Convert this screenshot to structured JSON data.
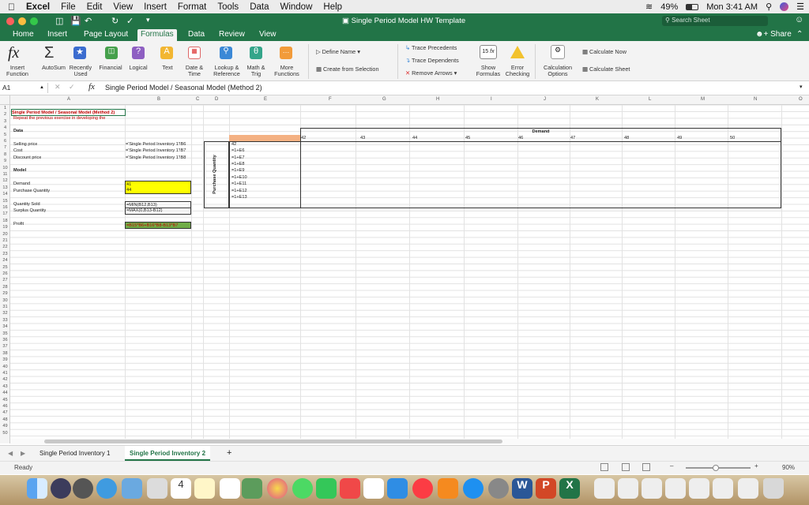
{
  "menubar": {
    "app": "Excel",
    "items": [
      "File",
      "Edit",
      "View",
      "Insert",
      "Format",
      "Tools",
      "Data",
      "Window",
      "Help"
    ],
    "battery": "49%",
    "clock": "Mon 3:41 AM"
  },
  "window": {
    "title": "Single Period Model HW Template",
    "search_placeholder": "Search Sheet"
  },
  "ribbon_tabs": [
    "Home",
    "Insert",
    "Page Layout",
    "Formulas",
    "Data",
    "Review",
    "View"
  ],
  "active_tab": "Formulas",
  "share_label": "Share",
  "ribbon": {
    "insert_function": "Insert\nFunction",
    "autosum": "AutoSum",
    "recently_used": "Recently\nUsed",
    "financial": "Financial",
    "logical": "Logical",
    "text": "Text",
    "date_time": "Date &\nTime",
    "lookup": "Lookup &\nReference",
    "math": "Math &\nTrig",
    "more": "More\nFunctions",
    "define_name": "Define Name",
    "create_from_selection": "Create from Selection",
    "trace_precedents": "Trace Precedents",
    "trace_dependents": "Trace Dependents",
    "remove_arrows": "Remove Arrows",
    "show_formulas": "Show\nFormulas",
    "error_checking": "Error\nChecking",
    "calc_options": "Calculation\nOptions",
    "calculate_now": "Calculate Now",
    "calculate_sheet": "Calculate Sheet"
  },
  "formula_bar": {
    "name_box": "A1",
    "formula": "Single Period Model / Seasonal Model (Method 2)"
  },
  "columns": [
    "A",
    "B",
    "C",
    "D",
    "E",
    "F",
    "G",
    "H",
    "I",
    "J",
    "K",
    "L",
    "M",
    "N",
    "O"
  ],
  "rows_count": 50,
  "cells": {
    "a1": "Single Period Model / Seasonal Model (Method 2)",
    "a2": "Repeat the previous exercise in developing the",
    "a4": "Data",
    "a6": "Selling price",
    "a7": "Cost",
    "a8": "Discount price",
    "a10": "Model",
    "a12": "Demand",
    "a13": "Purchase Quantity",
    "a15": "Quantity Sold",
    "a16": "Surplus Quantity",
    "a18": "Profit",
    "b6": "='Single Period Inventory 1'!B6",
    "b7": "='Single Period Inventory 1'!B7",
    "b8": "='Single Period Inventory 1'!B8",
    "b12": "41",
    "b13": "44",
    "b15": "=MIN(B12,B13)",
    "b16": "=MAX(0,B13-B12)",
    "b18": "=B15*B6+B16*B8-B13*B7",
    "demand_header": "Demand",
    "purchase_label": "Purchase Quantity",
    "e6": "42",
    "e7": "=1+E6",
    "e8": "=1+E7",
    "e9": "=1+E8",
    "e10": "=1+E9",
    "e11": "=1+E10",
    "e12": "=1+E11",
    "e13": "=1+E12",
    "e14": "=1+E13",
    "demand_values": [
      "42",
      "43",
      "44",
      "45",
      "46",
      "47",
      "48",
      "49",
      "50"
    ]
  },
  "sheet_tabs": [
    "Single Period Inventory 1",
    "Single Period Inventory 2"
  ],
  "active_sheet": "Single Period Inventory 2",
  "status": {
    "ready": "Ready",
    "zoom": "90%"
  },
  "colors": {
    "excel_green": "#227447",
    "yellow": "#ffff00",
    "orange_fill": "#f4b183",
    "red_text": "#c00000",
    "highlight_green": "#70ad47"
  }
}
